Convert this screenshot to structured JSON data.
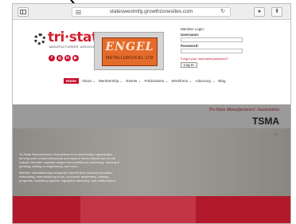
{
  "browser": {
    "url": "stateswestmfg.growthzonesites.com",
    "reload_icon": "↻",
    "share_icon": "⬆",
    "ext_icon": "●"
  },
  "header": {
    "logo_text": "tri·state",
    "logo_sub": "MANUFACTURERS' ASSOCIATION",
    "socials": [
      "f",
      "◎",
      "in",
      "▶"
    ],
    "engel": {
      "name": "ENGEL",
      "sub": "METALLURGICAL LTD"
    }
  },
  "login": {
    "title": "Member Login:",
    "username_label": "Username:",
    "password_label": "Password:",
    "forgot": "Forgot your username/password?",
    "login_button": "Log In"
  },
  "nav": {
    "items": [
      "Home",
      "About ⌄",
      "Membership ⌄",
      "Events ⌄",
      "Publications ⌄",
      "Workforce ⌄",
      "Advocacy ⌄",
      "Blog"
    ]
  },
  "hero": {
    "assoc": "Tri-State Manufacturers' Association",
    "abbr": "TSMA",
    "chevron": "⌄",
    "para1": "Tri-State Manufacturers' Association is a membership organization serving west central Minnesota and eastern North Dakota and South Dakota. Member capacity ranges from welding to machining, forming to grinding, plating to engineering, and more.",
    "para2": "Member manufacturing companies benefit from industry education, networking, manufacturing tours, consumer awareness, training programs, marketing options, legislative advocacy, and collaboration."
  },
  "colors": {
    "brand_red": "#c8102e",
    "band_gray": "#9a9a9a"
  }
}
